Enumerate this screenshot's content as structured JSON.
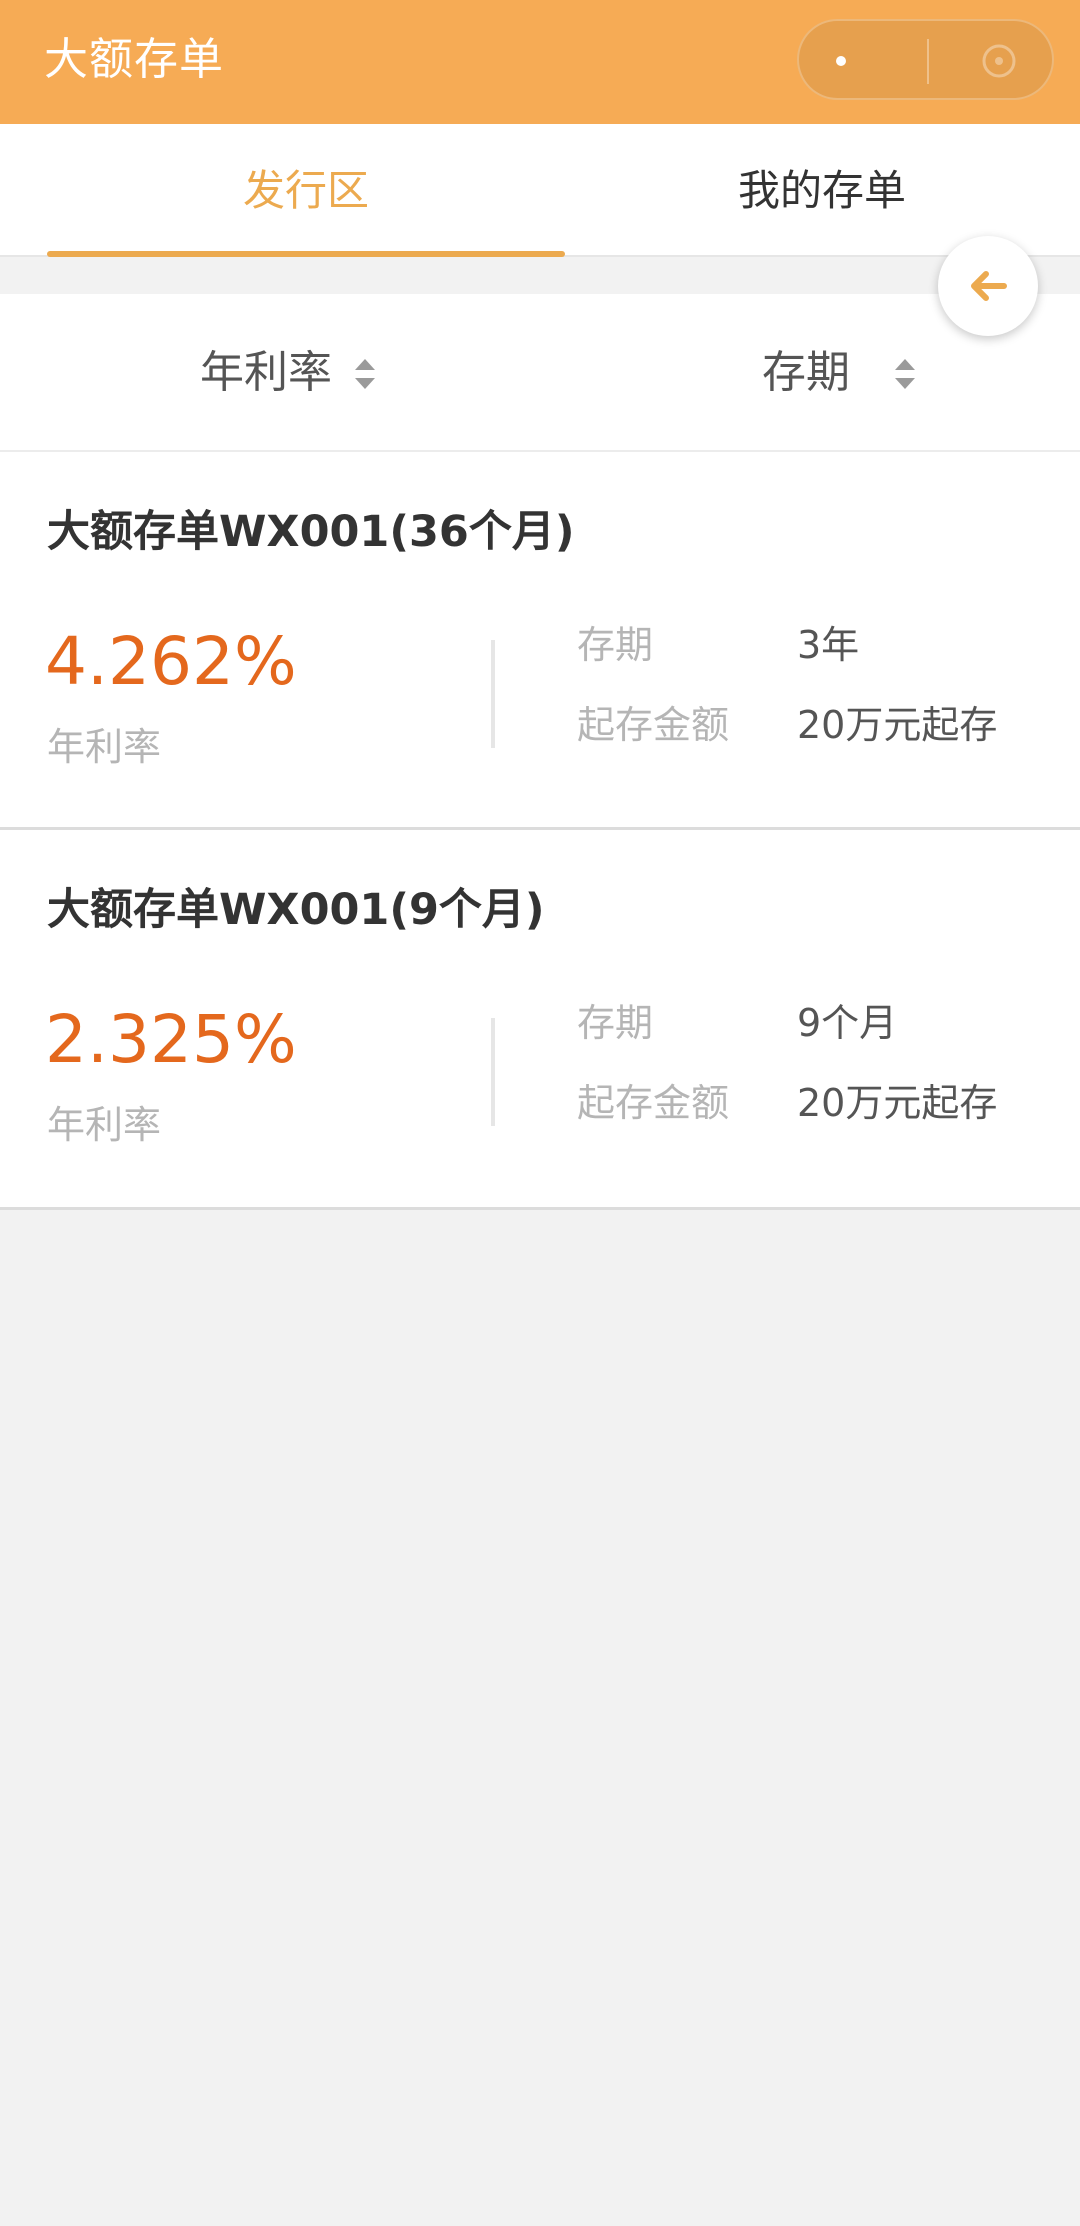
{
  "header": {
    "title": "大额存单"
  },
  "tabs": [
    {
      "label": "发行区",
      "active": true
    },
    {
      "label": "我的存单",
      "active": false
    }
  ],
  "sort": {
    "rate_label": "年利率",
    "term_label": "存期"
  },
  "products": [
    {
      "title": "大额存单WX001(36个月)",
      "rate": "4.262%",
      "rate_label": "年利率",
      "term_label": "存期",
      "term_value": "3年",
      "min_label": "起存金额",
      "min_value": "20万元起存"
    },
    {
      "title": "大额存单WX001(9个月)",
      "rate": "2.325%",
      "rate_label": "年利率",
      "term_label": "存期",
      "term_value": "9个月",
      "min_label": "起存金额",
      "min_value": "20万元起存"
    }
  ],
  "icons": {
    "back": "arrow-left-icon",
    "sort": "sort-arrows-icon"
  },
  "colors": {
    "header_bg": "#f6ab55",
    "accent": "#ecaa4f",
    "rate": "#e4681d",
    "background": "#f2f2f2"
  }
}
